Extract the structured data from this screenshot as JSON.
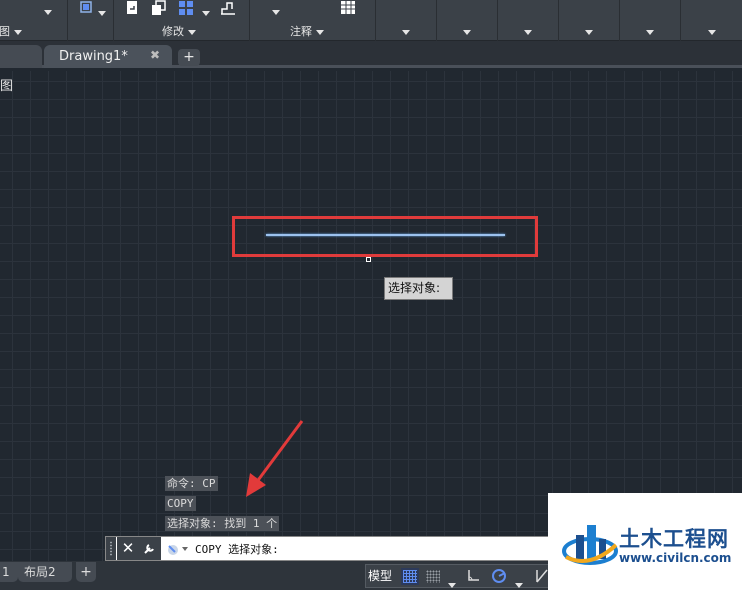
{
  "ribbon": {
    "panels": {
      "draw": {
        "title": "绘图"
      },
      "modify": {
        "title": "修改"
      },
      "annotation": {
        "title": "注释"
      }
    },
    "icons": [
      "crop-icon",
      "insert-icon",
      "copy-icon",
      "array-icon",
      "stretch-icon",
      "table-icon"
    ]
  },
  "tabs": {
    "active": {
      "label": "Drawing1*"
    },
    "close_glyph": "✖",
    "new_glyph": "+"
  },
  "canvas": {
    "view_label": "俯视图",
    "view_label_visible": "图",
    "tooltip": "选择对象:"
  },
  "command": {
    "history": [
      "命令: CP",
      "COPY",
      "选择对象: 找到 1 个"
    ],
    "prompt": "COPY 选择对象:",
    "close_glyph": "✕",
    "customize_glyph": "🔧"
  },
  "statusbar": {
    "layouts": [
      "1",
      "布局2"
    ],
    "add_layout": "+",
    "model": "模型"
  },
  "watermark": {
    "name": "土木工程网",
    "url": "www.civilcn.com"
  },
  "colors": {
    "canvas_bg": "#212830",
    "highlight": "#e03b3b",
    "line": "#9cc2ee",
    "accent": "#5f8df0"
  }
}
